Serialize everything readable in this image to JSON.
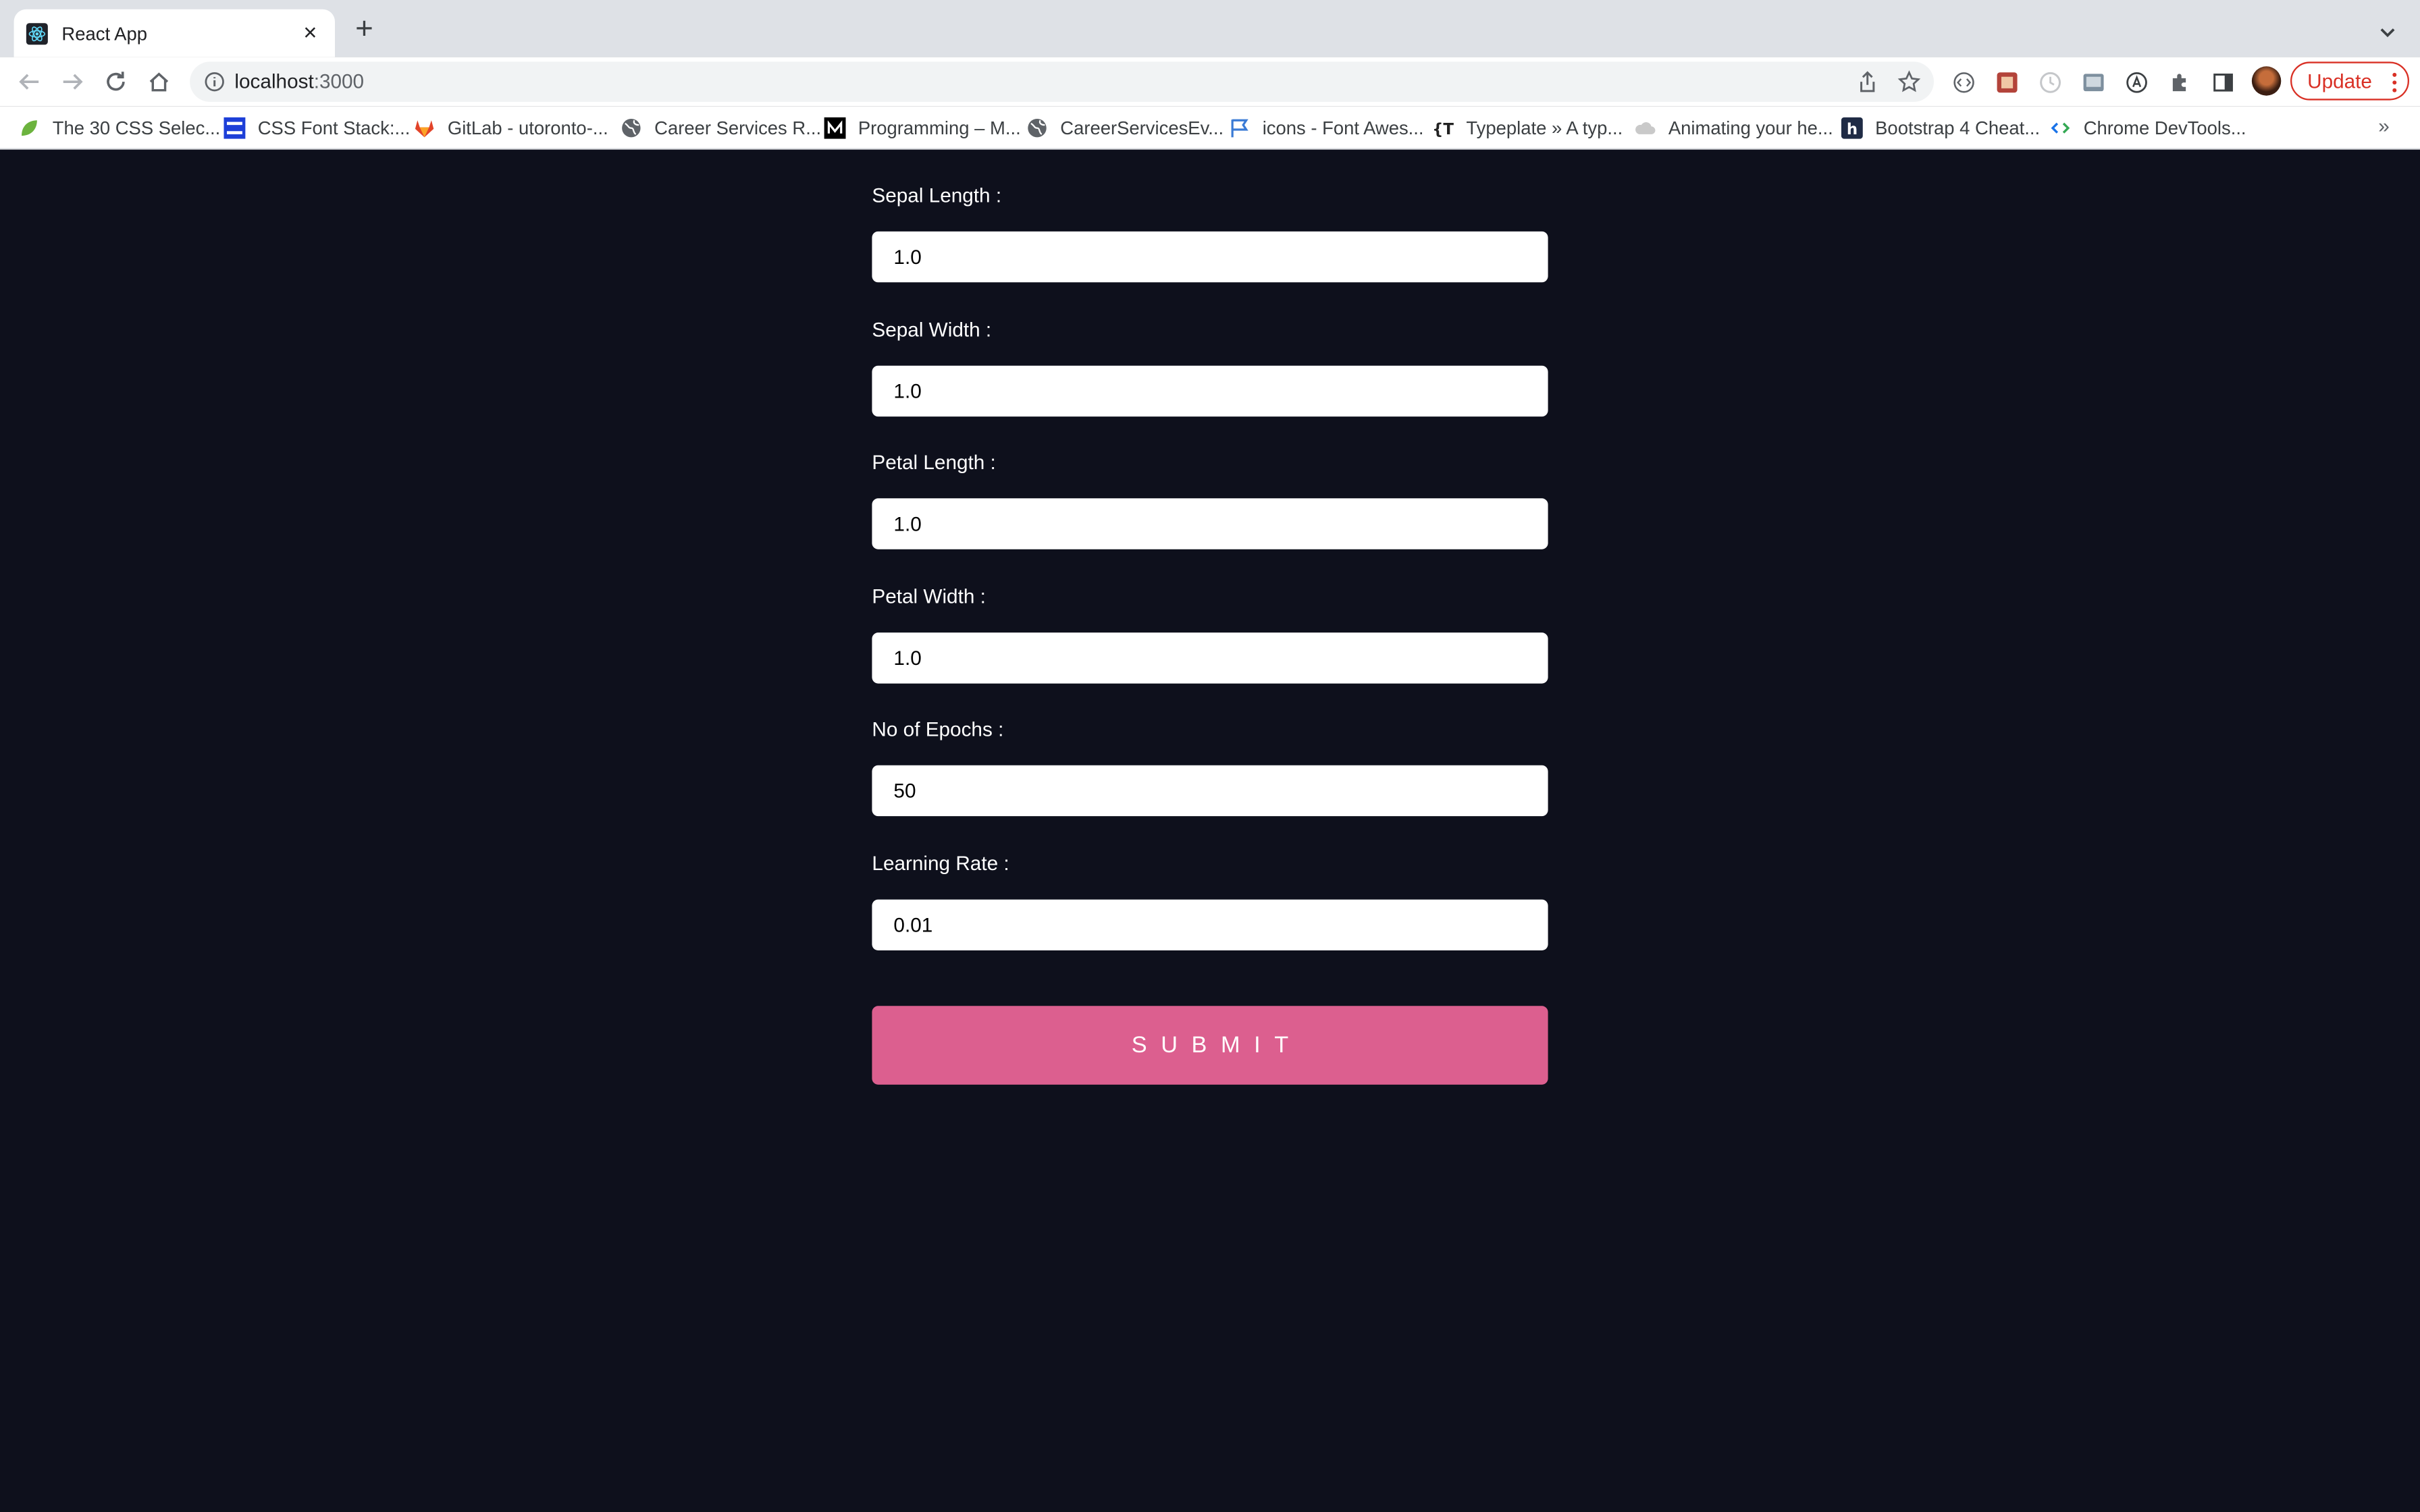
{
  "tab": {
    "title": "React App",
    "favicon": "react-icon"
  },
  "address_bar": {
    "host": "localhost",
    "port": ":3000"
  },
  "update_button": {
    "label": "Update",
    "color": "#d93025"
  },
  "bookmarks": [
    {
      "label": "The 30 CSS Selec...",
      "icon": "leaf-icon"
    },
    {
      "label": "CSS Font Stack:...",
      "icon": "cssfontstack-icon"
    },
    {
      "label": "GitLab - utoronto-...",
      "icon": "gitlab-icon"
    },
    {
      "label": "Career Services R...",
      "icon": "globe-icon"
    },
    {
      "label": "Programming – M...",
      "icon": "medium-icon"
    },
    {
      "label": "CareerServicesEv...",
      "icon": "globe-icon"
    },
    {
      "label": "icons - Font Awes...",
      "icon": "flag-icon"
    },
    {
      "label": "Typeplate » A typ...",
      "icon": "typeplate-icon"
    },
    {
      "label": "Animating your he...",
      "icon": "cloud-icon"
    },
    {
      "label": "Bootstrap 4 Cheat...",
      "icon": "bootstrap-icon"
    },
    {
      "label": "Chrome DevTools...",
      "icon": "devtools-icon"
    }
  ],
  "bookmarks_overflow": "»",
  "form": {
    "fields": [
      {
        "label": "Sepal Length :",
        "value": "1.0"
      },
      {
        "label": "Sepal Width :",
        "value": "1.0"
      },
      {
        "label": "Petal Length :",
        "value": "1.0"
      },
      {
        "label": "Petal Width :",
        "value": "1.0"
      },
      {
        "label": "No of Epochs :",
        "value": "50"
      },
      {
        "label": "Learning Rate :",
        "value": "0.01"
      }
    ],
    "submit_label": "SUBMIT"
  },
  "colors": {
    "background": "#0e101c",
    "accent": "#dc5f8f"
  }
}
